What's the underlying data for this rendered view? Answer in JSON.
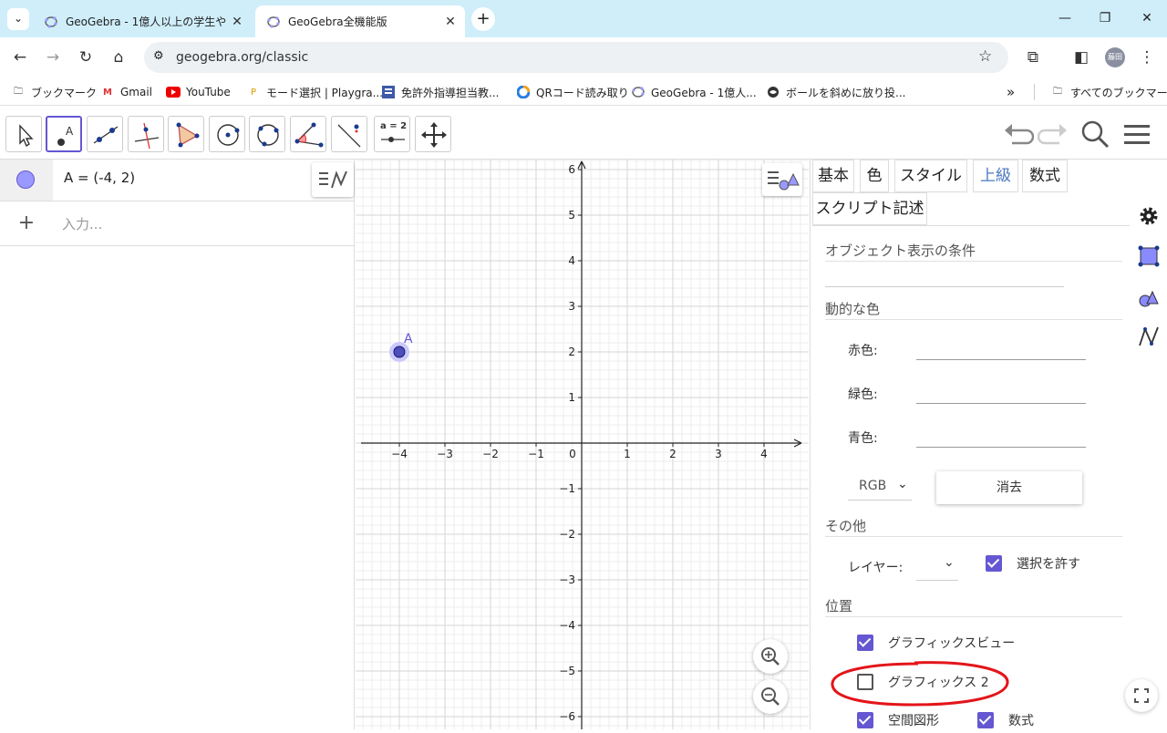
{
  "browser": {
    "tabs": [
      {
        "title": "GeoGebra - 1億人以上の学生や"
      },
      {
        "title": "GeoGebra全機能版"
      }
    ],
    "url": "geogebra.org/classic",
    "profile_label": "藤田",
    "bookmarks": [
      {
        "label": "ブックマーク"
      },
      {
        "label": "Gmail"
      },
      {
        "label": "YouTube"
      },
      {
        "label": "モード選択 | Playgra..."
      },
      {
        "label": "免許外指導担当教..."
      },
      {
        "label": "QRコード読み取り"
      },
      {
        "label": "GeoGebra - 1億人..."
      },
      {
        "label": "ボールを斜めに放り投..."
      }
    ],
    "all_bookmarks_label": "すべてのブックマーク",
    "new_tab_symbol": "+",
    "more_symbol": "»"
  },
  "ggb_toolbar": {
    "tools": [
      "move-tool",
      "point-tool",
      "line-tool",
      "perpendicular-tool",
      "polygon-tool",
      "circle-tool",
      "conic-tool",
      "angle-tool",
      "reflect-tool",
      "slider-tool",
      "move-graphics-tool"
    ],
    "slider_label": "a = 2"
  },
  "algebra": {
    "entry": "A = (-4, 2)",
    "input_placeholder": "入力..."
  },
  "graphics": {
    "x_ticks": [
      "−4",
      "−3",
      "−2",
      "−1",
      "0",
      "1",
      "2",
      "3",
      "4"
    ],
    "y_ticks": [
      "6",
      "5",
      "4",
      "3",
      "2",
      "1",
      "−1",
      "−2",
      "−3",
      "−4",
      "−5",
      "−6"
    ],
    "point": {
      "name": "A",
      "x": -4,
      "y": 2
    },
    "accent": "#6557d2"
  },
  "properties": {
    "tabs": [
      "基本",
      "色",
      "スタイル",
      "上級",
      "数式",
      "スクリプト記述"
    ],
    "active_tab": "上級",
    "condition_label": "オブジェクト表示の条件",
    "dynamic_color_label": "動的な色",
    "red_label": "赤色:",
    "green_label": "緑色:",
    "blue_label": "青色:",
    "color_mode": "RGB",
    "clear_button": "消去",
    "other_label": "その他",
    "layer_label": "レイヤー:",
    "allow_select_label": "選択を許す",
    "position_label": "位置",
    "graphics_view_label": "グラフィックスビュー",
    "graphics2_label": "グラフィックス 2",
    "space_label": "空間図形",
    "formula_label": "数式",
    "checks": {
      "allow_select": true,
      "graphics_view": true,
      "graphics2": false,
      "space": true,
      "formula": true
    }
  }
}
